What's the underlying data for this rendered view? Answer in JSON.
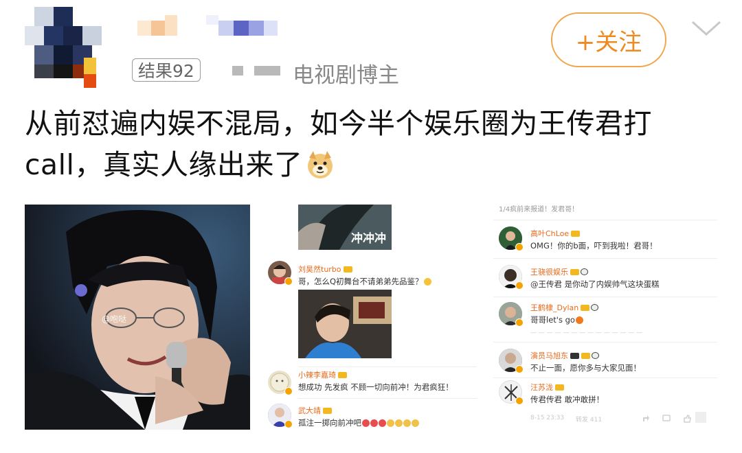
{
  "header": {
    "follow_label": "+关注",
    "badge_label": "结果92",
    "user_category": "电视剧博主"
  },
  "post": {
    "text": "从前怼遍内娱不混局，如今半个娱乐圈为王传君打call，真实人缘出来了"
  },
  "image1": {
    "watermark": "@咆哒"
  },
  "image2": {
    "video_caption": "冲冲冲",
    "comments": [
      {
        "name": "刘昊然turbo",
        "text": "哥，怎么Q初舞台不请弟弟先品鉴？"
      },
      {
        "name": "小辣李嘉琦",
        "text": "想成功 先发疯 不顾一切向前冲！为君疯狂！"
      },
      {
        "name": "武大靖",
        "text": "孤注一掷向前冲吧"
      }
    ]
  },
  "image3": {
    "top_faint": "1/4疯前来报道！发君哥！",
    "comments": [
      {
        "name": "高叶ChLoe",
        "text": "OMG！你的b面，吓到我啦！君哥！"
      },
      {
        "name": "王骁很娱乐",
        "text": "@王传君 是你动了内娱帅气这块蛋糕"
      },
      {
        "name": "王鹤棣_Dylan",
        "text": "哥哥let's go"
      },
      {
        "name": "演员马旭东",
        "text": "不止一面，愿你多与大家见面！"
      },
      {
        "name": "汪苏泷",
        "text": "传君传君 敢冲敢拼！"
      }
    ],
    "footer_time": "8-15 23:33",
    "footer_forward": "转发 411"
  },
  "colors": {
    "accent": "#ee8a1f",
    "comment_name": "#e86a1c",
    "meta_gray": "#888888"
  }
}
